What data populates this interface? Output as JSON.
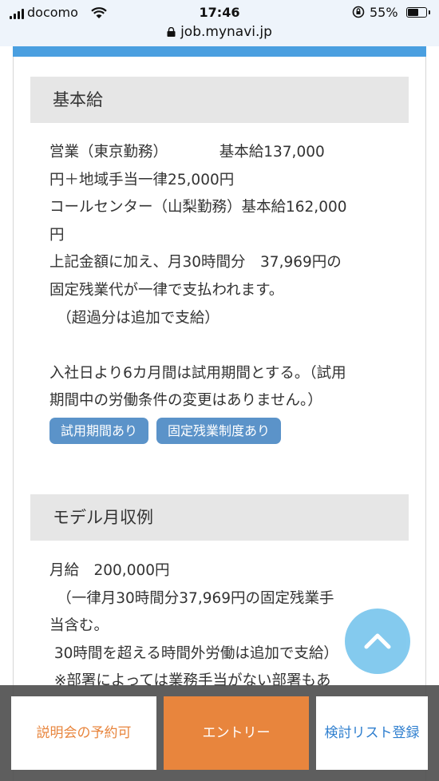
{
  "status_bar": {
    "carrier": "docomo",
    "time": "17:46",
    "battery": "55%",
    "battery_level": 0.55,
    "url": "job.mynavi.jp"
  },
  "salary_section": {
    "heading": "基本給",
    "lines": [
      "営業（東京勤務）　　　　基本給137,000",
      "円＋地域手当一律25,000円",
      "コールセンター（山梨勤務）基本給162,000",
      "円",
      "上記金額に加え、月30時間分　37,969円の",
      "固定残業代が一律で支払われます。",
      "　（超過分は追加で支給）",
      "",
      "入社日より6カ月間は試用期間とする。（試用",
      "期間中の労働条件の変更はありません。）"
    ],
    "tags": [
      "試用期間あり",
      "固定残業制度あり"
    ]
  },
  "model_section": {
    "heading": "モデル月収例",
    "lines": [
      "月給　200,000円",
      "　（一律月30時間分37,969円の固定残業手",
      "当含む。",
      " 30時間を超える時間外労働は追加で支給）",
      " ※部署によっては業務手当がない部署もあ"
    ]
  },
  "bottom_bar": {
    "seminar_label": "説明会の予約可",
    "entry_label": "エントリー",
    "list_label": "検討リスト登録"
  },
  "colors": {
    "accent_blue": "#4a9fe0",
    "tag_blue": "#5b93c9",
    "entry_orange": "#e8853d",
    "list_blue": "#2f7fcf"
  },
  "icons": [
    "signal-icon",
    "wifi-icon",
    "orientation-lock-icon",
    "battery-icon",
    "lock-icon",
    "chevron-up-icon"
  ]
}
